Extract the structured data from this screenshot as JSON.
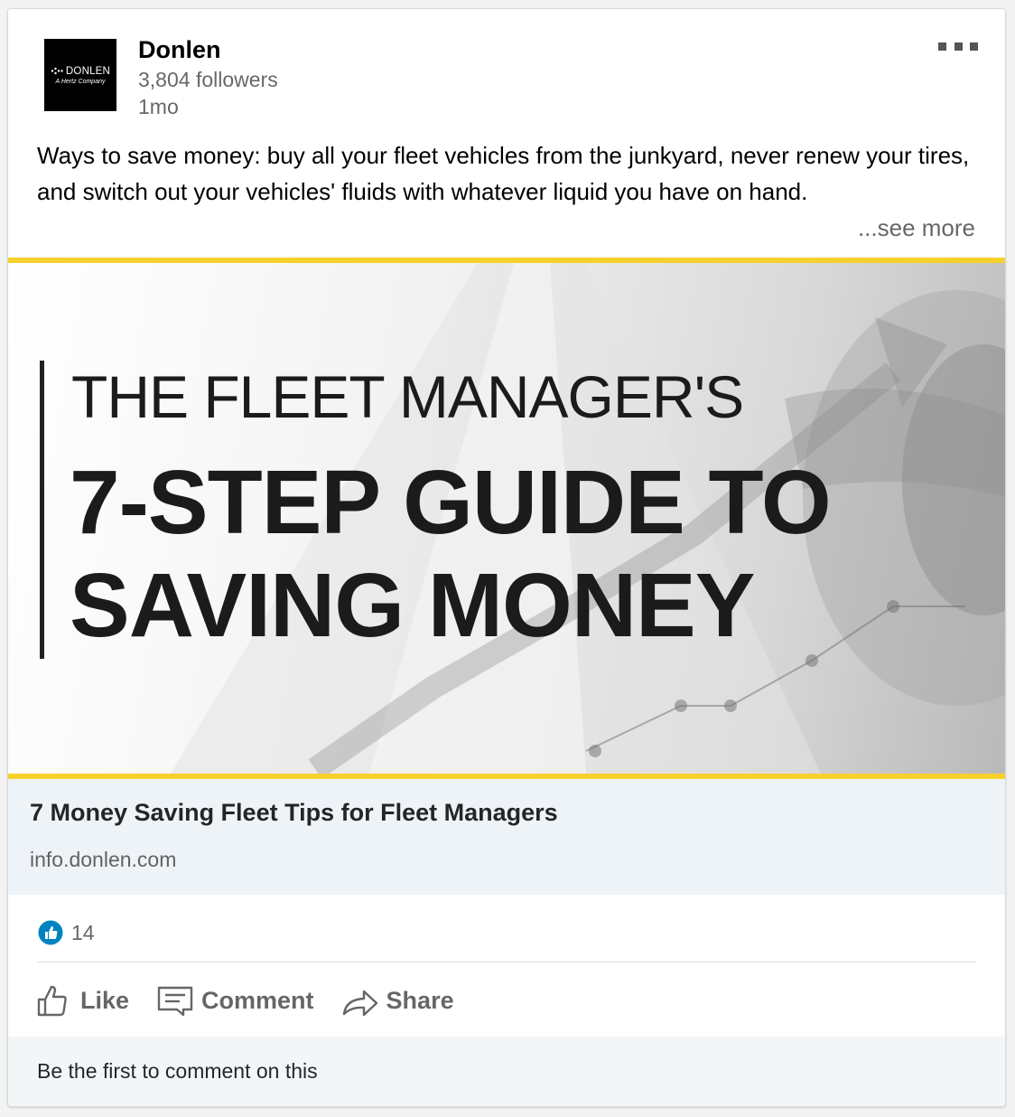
{
  "post": {
    "author": {
      "name": "Donlen",
      "followers": "3,804 followers",
      "timestamp": "1mo",
      "logo_text": "DONLEN",
      "logo_subtext": "A Hertz Company"
    },
    "text": "Ways to save money: buy all your fleet vehicles from the junkyard, never renew your tires, and switch out your vehicles' fluids with whatever liquid you have on hand.",
    "see_more_label": "...see more"
  },
  "media": {
    "headline_line1": "THE FLEET MANAGER'S",
    "headline_line2": "7-STEP GUIDE TO",
    "headline_line3": "SAVING MONEY",
    "accent_color": "#f6d12c"
  },
  "link_preview": {
    "title": "7 Money Saving Fleet Tips for Fleet Managers",
    "domain": "info.donlen.com"
  },
  "social": {
    "reaction_count": "14",
    "reaction_icon": "like-icon"
  },
  "actions": {
    "like_label": "Like",
    "comment_label": "Comment",
    "share_label": "Share"
  },
  "footer": {
    "comment_prompt": "Be the first to comment on this"
  }
}
